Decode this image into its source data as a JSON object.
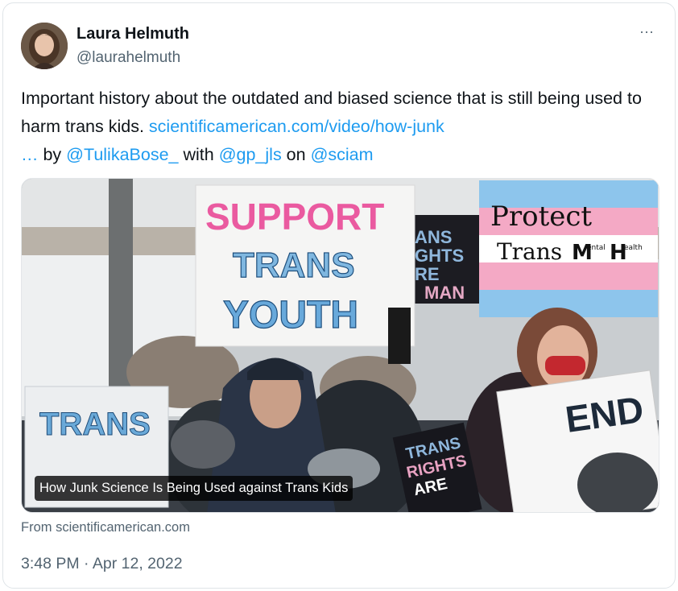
{
  "author": {
    "name": "Laura Helmuth",
    "handle": "@laurahelmuth"
  },
  "menu": {
    "more_label": "···",
    "more_icon": "more-horizontal-icon"
  },
  "tweet": {
    "text_part1": "Important history about the outdated and biased science that is still being used to harm trans kids. ",
    "link_url": "scientificamerican.com/video/how-junk",
    "ellipsis": " …",
    "by": " by ",
    "mention1": "@TulikaBose_",
    "with": " with ",
    "mention2": "@gp_jls",
    "on": " on ",
    "mention3": "@sciam"
  },
  "media": {
    "caption": "How Junk Science Is Being Used against Trans Kids",
    "signs": {
      "support_line1": "SUPPORT",
      "support_line2": "TRANS",
      "support_line3": "YOUTH",
      "protect_line1": "Protect",
      "protect_line2": "Trans",
      "protect_m": "M",
      "protect_ental": "ental",
      "protect_h": "H",
      "protect_ealth": "ealth",
      "end": "END",
      "trans_left": "TRANS",
      "trans_rights_1": "TRANS",
      "trans_rights_2": "RIGHTS",
      "trans_rights_3": "ARE",
      "bg_sign_1": "ANS",
      "bg_sign_2": "GHTS",
      "bg_sign_3": "RE",
      "bg_sign_4": "MAN"
    }
  },
  "source": "From scientificamerican.com",
  "timestamp": "3:48 PM · Apr 12, 2022",
  "colors": {
    "text": "#0f1419",
    "secondary": "#536471",
    "link": "#1d9bf0",
    "border": "#dfe4e8"
  }
}
